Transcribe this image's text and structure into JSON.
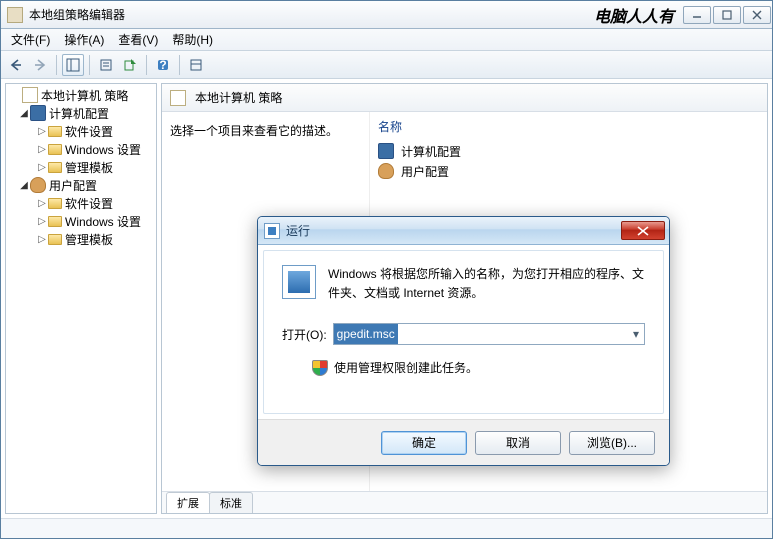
{
  "window": {
    "title": "本地组策略编辑器",
    "brand": "电脑人人有"
  },
  "menu": {
    "file": "文件(F)",
    "action": "操作(A)",
    "view": "查看(V)",
    "help": "帮助(H)"
  },
  "tree": {
    "root": "本地计算机 策略",
    "computer": "计算机配置",
    "user": "用户配置",
    "software": "软件设置",
    "windows": "Windows 设置",
    "templates": "管理模板"
  },
  "detail": {
    "header": "本地计算机 策略",
    "prompt": "选择一个项目来查看它的描述。",
    "col_name": "名称",
    "item_computer": "计算机配置",
    "item_user": "用户配置",
    "tab_ext": "扩展",
    "tab_std": "标准"
  },
  "run": {
    "title": "运行",
    "desc": "Windows 将根据您所输入的名称，为您打开相应的程序、文件夹、文档或 Internet 资源。",
    "open_label": "打开(O):",
    "value": "gpedit.msc",
    "admin_note": "使用管理权限创建此任务。",
    "ok": "确定",
    "cancel": "取消",
    "browse": "浏览(B)..."
  }
}
